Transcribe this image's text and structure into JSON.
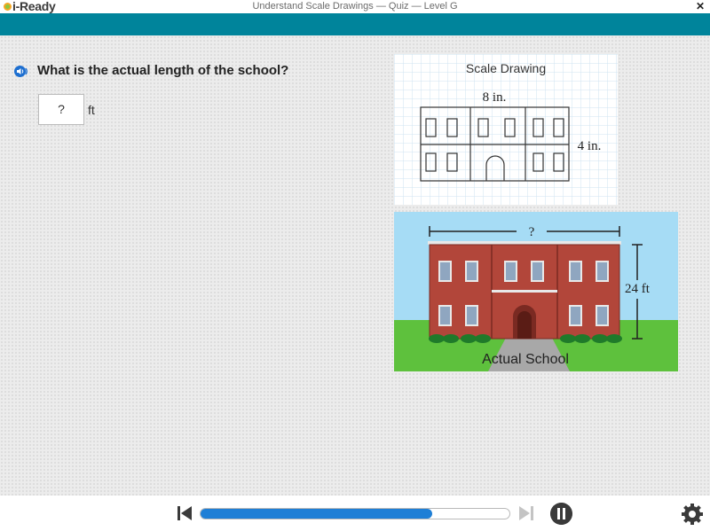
{
  "app": {
    "logo_text": "i-Ready",
    "window_title": "Understand Scale Drawings — Quiz — Level G",
    "close_glyph": "✕"
  },
  "question": {
    "text": "What is the actual length of the school?",
    "answer_value": "?",
    "answer_unit": "ft"
  },
  "scale_drawing": {
    "title": "Scale Drawing",
    "length_label": "8 in.",
    "width_label": "4 in."
  },
  "actual_school": {
    "caption": "Actual School",
    "length_label": "?",
    "height_label": "24 ft"
  },
  "footer": {
    "progress_percent": 75
  },
  "colors": {
    "header_band": "#00849b",
    "progress_fill": "#1f7fd6",
    "brick": "#b2463a",
    "sky": "#a6dcf5",
    "grass": "#5ec13d"
  },
  "icons": {
    "speaker": "speaker-icon",
    "skip_back": "skip-back-icon",
    "skip_forward": "skip-forward-icon",
    "pause": "pause-icon",
    "settings": "gear-icon"
  }
}
